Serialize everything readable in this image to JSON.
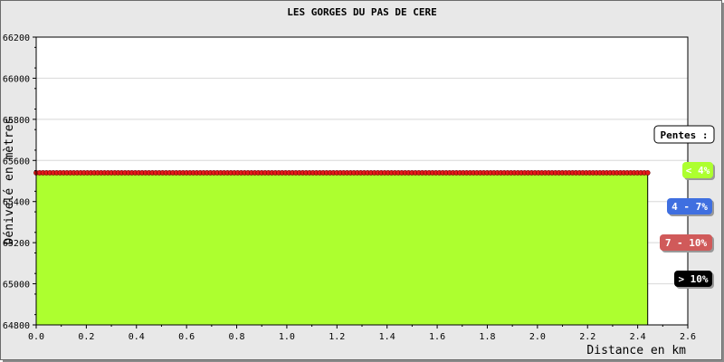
{
  "chart_data": {
    "type": "area",
    "title": "LES GORGES DU PAS DE CERE",
    "xlabel": "Distance en km",
    "ylabel": "Dénivelé en mètres",
    "xlim": [
      0.0,
      2.6
    ],
    "ylim": [
      64800,
      66200
    ],
    "x_ticks": [
      "0.0",
      "0.2",
      "0.4",
      "0.6",
      "0.8",
      "1.0",
      "1.2",
      "1.4",
      "1.6",
      "1.8",
      "2.0",
      "2.2",
      "2.4",
      "2.6"
    ],
    "y_ticks": [
      "64800",
      "65000",
      "65200",
      "65400",
      "65600",
      "65800",
      "66000",
      "66200"
    ],
    "grid": "horizontal",
    "fill_color": "#adff2f",
    "marker_color": "#e41a1a",
    "series": [
      {
        "profile_x": [
          0.0,
          2.44
        ],
        "profile_y": [
          65540,
          65540
        ],
        "point_x_start": 0.0,
        "point_x_end": 2.44,
        "point_count": 180
      }
    ],
    "legend": {
      "title": "Pentes :",
      "position": "right",
      "items": [
        {
          "label": "< 4%",
          "color": "#adff2f",
          "text_color": "#ffffff"
        },
        {
          "label": "4 - 7%",
          "color": "#3f6fe0",
          "text_color": "#ffffff"
        },
        {
          "label": "7 - 10%",
          "color": "#d05a5a",
          "text_color": "#ffffff"
        },
        {
          "label": "> 10%",
          "color": "#000000",
          "text_color": "#ffffff"
        }
      ]
    }
  }
}
